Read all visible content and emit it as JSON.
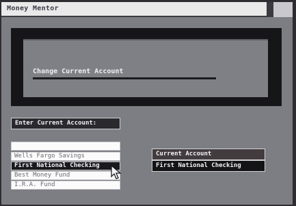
{
  "window": {
    "title": "Money Mentor"
  },
  "panel": {
    "heading": "Change Current Account"
  },
  "entry": {
    "label": "Enter Current Account:",
    "value": ""
  },
  "account_list": {
    "items": [
      {
        "label": "Wells Fargo Savings",
        "selected": false
      },
      {
        "label": "First National Checking",
        "selected": true
      },
      {
        "label": "Best Money Fund",
        "selected": false
      },
      {
        "label": "I.R.A.  Fund",
        "selected": false
      }
    ]
  },
  "current_account": {
    "header": "Current Account",
    "value": "First National Checking"
  },
  "icons": {
    "pointer": "mouse-pointer-icon"
  },
  "colors": {
    "screen_bg": "#7d7e84",
    "frame": "#161618",
    "selected_row": "#1a1a1d"
  }
}
